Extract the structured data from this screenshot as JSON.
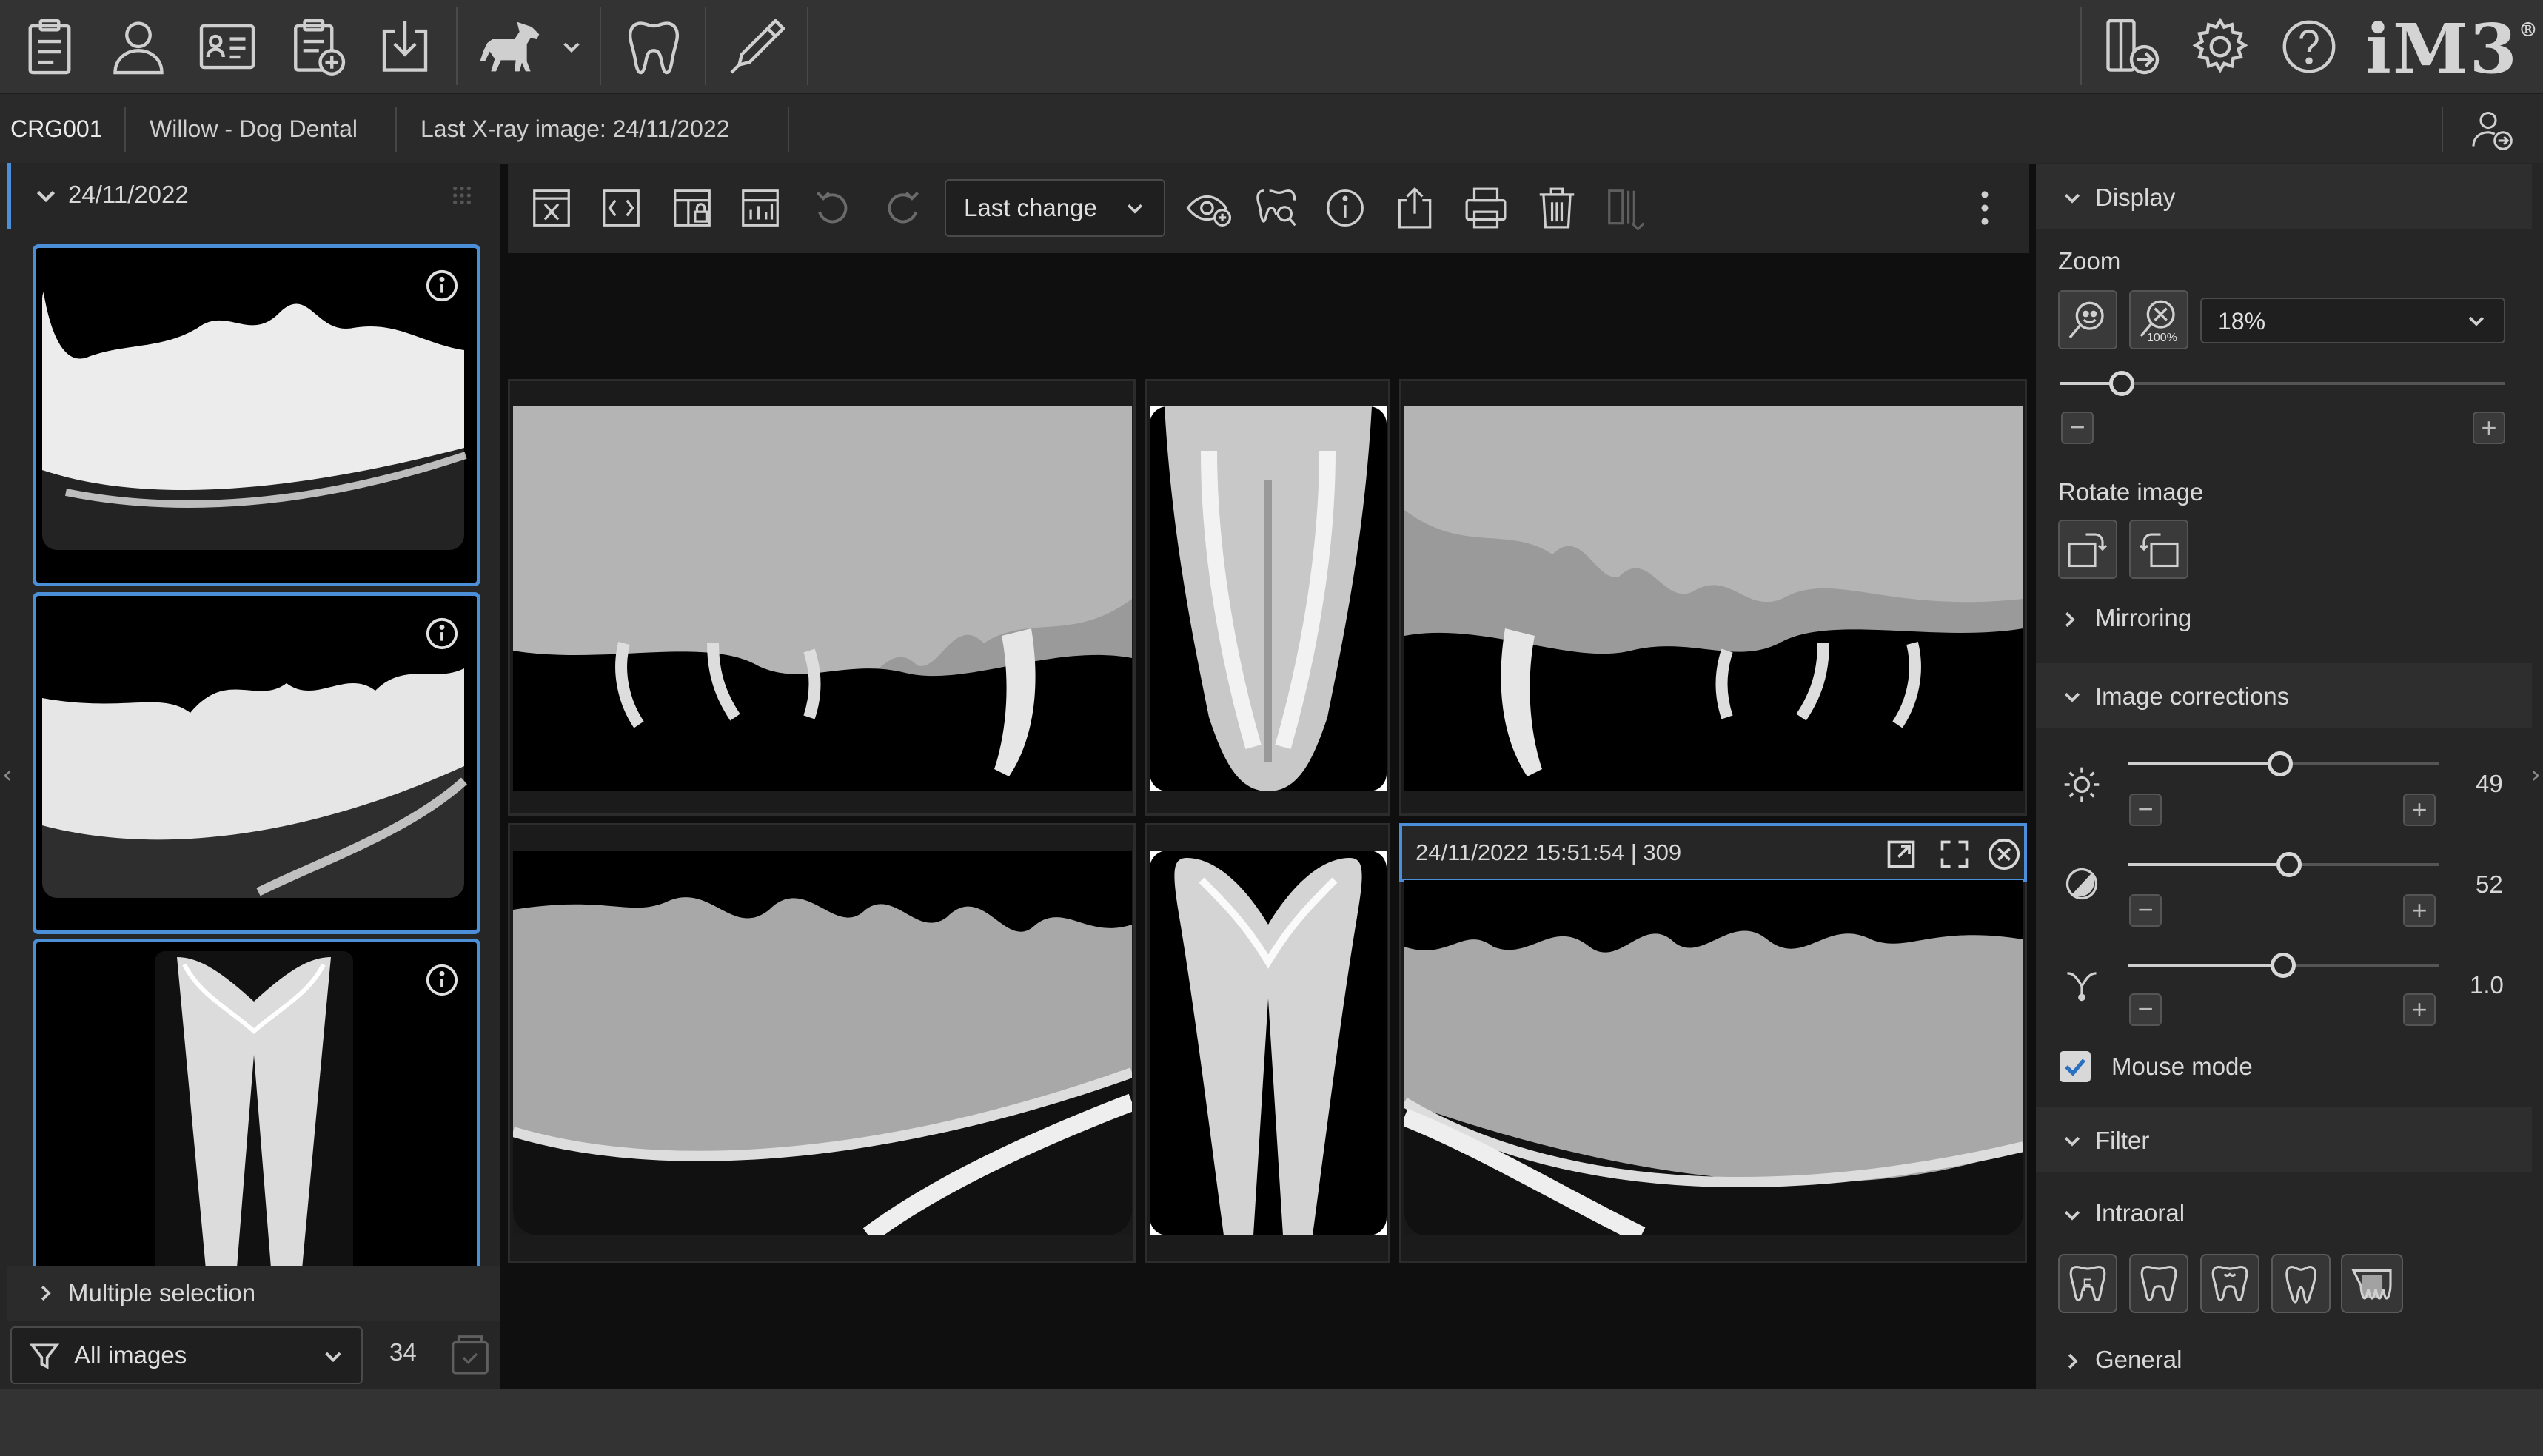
{
  "patient": {
    "id": "CRG001",
    "name": "Willow - Dog Dental",
    "last_xray": "Last X-ray image: 24/11/2022"
  },
  "logo": {
    "text": "iM3",
    "mark": "®"
  },
  "left_panel": {
    "date_group": "24/11/2022",
    "multiple_selection": "Multiple selection",
    "filter_value": "All images",
    "image_count": "34"
  },
  "center_toolbar": {
    "sort_label": "Last change"
  },
  "viewer": {
    "active_image_caption": "24/11/2022 15:51:54 | 309"
  },
  "right_panel": {
    "display": {
      "title": "Display",
      "zoom_label": "Zoom",
      "zoom_value": "18%",
      "zoom_icon_badge": "100%",
      "zoom_slider_fraction": 0.14,
      "rotate_label": "Rotate image",
      "mirroring_label": "Mirroring"
    },
    "image_corrections": {
      "title": "Image corrections",
      "brightness": "49",
      "contrast": "52",
      "gamma": "1.0",
      "brightness_fraction": 0.49,
      "contrast_fraction": 0.52,
      "gamma_fraction": 0.5,
      "mouse_mode_label": "Mouse mode",
      "mouse_mode_checked": true
    },
    "filter": {
      "title": "Filter",
      "intraoral_label": "Intraoral",
      "general_label": "General",
      "tooth_icon_letter": "F"
    }
  },
  "colors": {
    "accent": "#4a8fd8",
    "toolbar_bg": "#333333",
    "panel_bg": "#262626"
  }
}
